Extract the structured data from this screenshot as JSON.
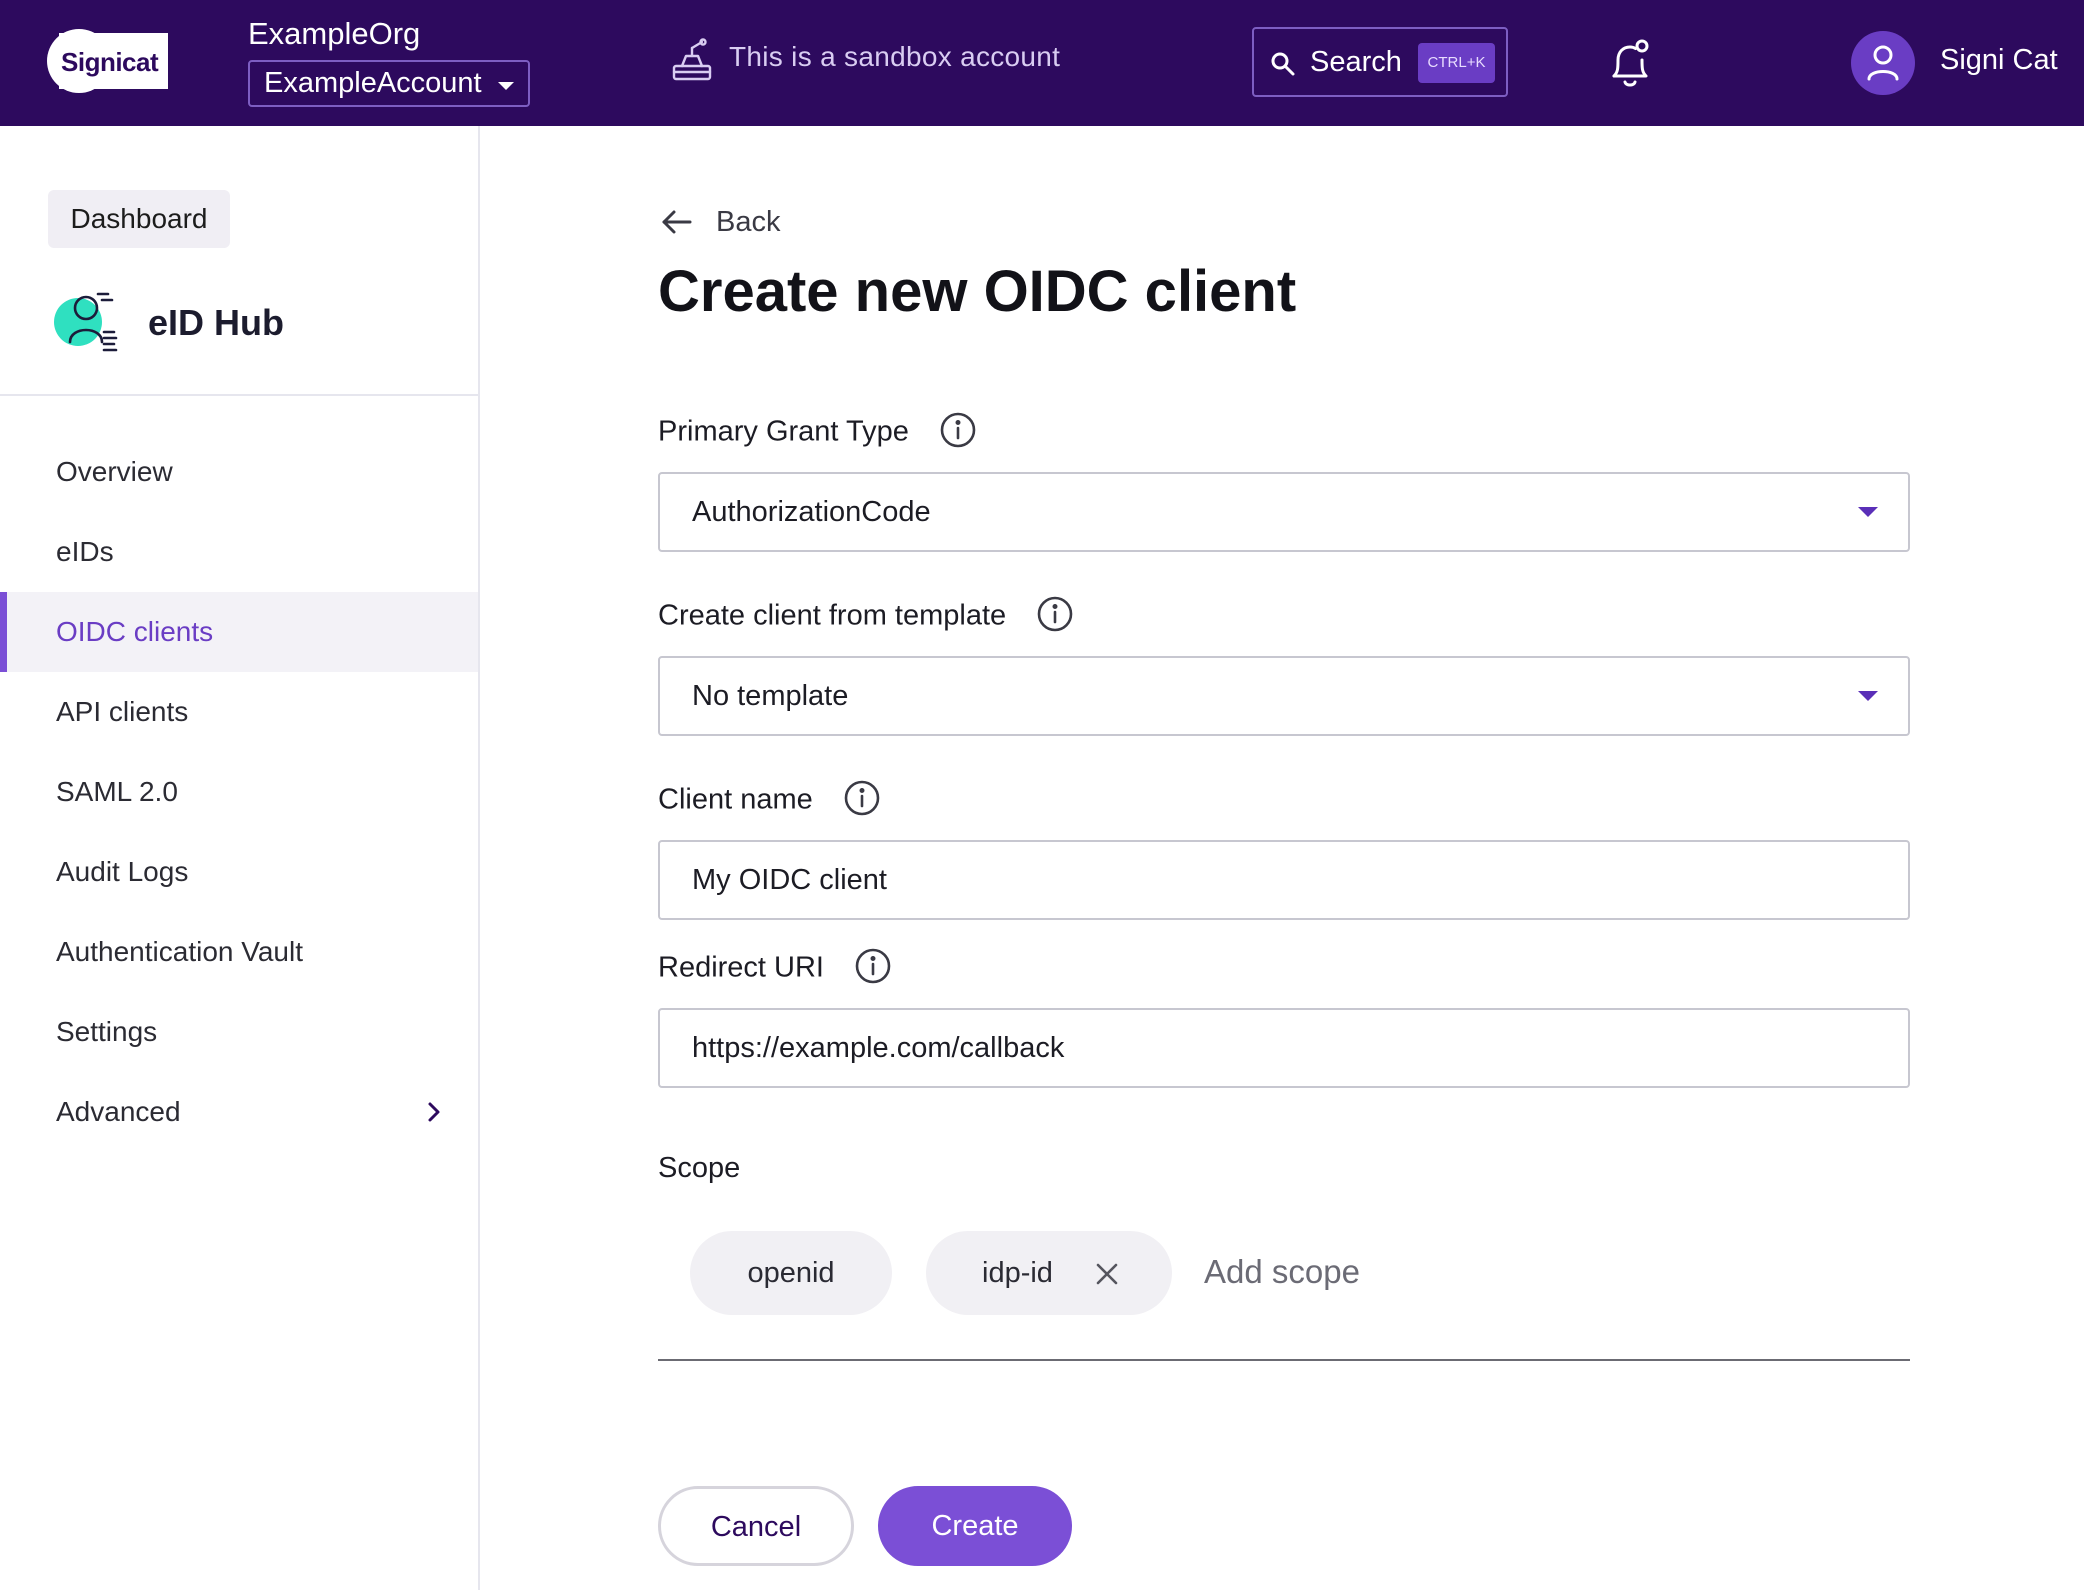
{
  "header": {
    "logo_text": "Signicat",
    "org_name": "ExampleOrg",
    "account": "ExampleAccount",
    "sandbox_notice": "This is a sandbox account",
    "search_label": "Search",
    "search_shortcut": "CTRL+K",
    "user_name": "Signi Cat",
    "colors": {
      "background": "#2d0a5e",
      "accent": "#6a3dc4"
    }
  },
  "sidebar": {
    "dashboard_label": "Dashboard",
    "product_name": "eID Hub",
    "items": [
      {
        "label": "Overview"
      },
      {
        "label": "eIDs"
      },
      {
        "label": "OIDC clients",
        "active": true
      },
      {
        "label": "API clients"
      },
      {
        "label": "SAML 2.0"
      },
      {
        "label": "Audit Logs"
      },
      {
        "label": "Authentication Vault"
      },
      {
        "label": "Settings"
      },
      {
        "label": "Advanced",
        "icon": "chevron-right-icon"
      }
    ]
  },
  "main": {
    "back_label": "Back",
    "title": "Create new OIDC client",
    "fields": {
      "grant_type": {
        "label": "Primary Grant Type",
        "value": "AuthorizationCode"
      },
      "template": {
        "label": "Create client from template",
        "value": "No template"
      },
      "client_name": {
        "label": "Client name",
        "value": "My OIDC client"
      },
      "redirect_uri": {
        "label": "Redirect URI",
        "value": "https://example.com/callback"
      }
    },
    "scope": {
      "label": "Scope",
      "chips": [
        "openid",
        "idp-id"
      ],
      "add_placeholder": "Add scope"
    },
    "buttons": {
      "cancel": "Cancel",
      "create": "Create"
    },
    "colors": {
      "primary": "#7b4fd6"
    }
  }
}
